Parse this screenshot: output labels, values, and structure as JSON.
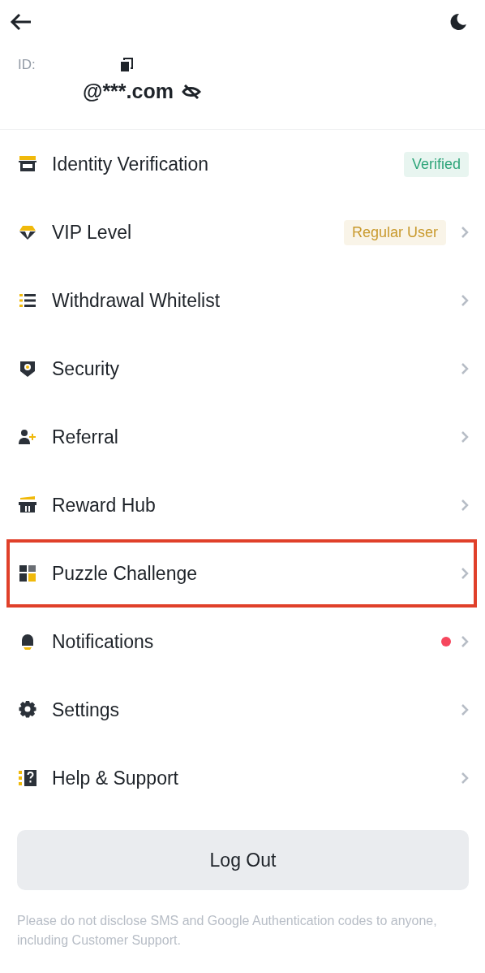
{
  "header": {
    "id_label": "ID:",
    "email": "@***.com"
  },
  "items": [
    {
      "label": "Identity Verification",
      "badge": {
        "text": "Verified",
        "color": "#2ea57a"
      },
      "chevron": false,
      "dot": false,
      "highlighted": false
    },
    {
      "label": "VIP Level",
      "badge": {
        "text": "Regular User",
        "color": "#c99a2e"
      },
      "chevron": true,
      "dot": false,
      "highlighted": false
    },
    {
      "label": "Withdrawal Whitelist",
      "chevron": true,
      "dot": false,
      "highlighted": false
    },
    {
      "label": "Security",
      "chevron": true,
      "dot": false,
      "highlighted": false
    },
    {
      "label": "Referral",
      "chevron": true,
      "dot": false,
      "highlighted": false
    },
    {
      "label": "Reward Hub",
      "chevron": true,
      "dot": false,
      "highlighted": false
    },
    {
      "label": "Puzzle Challenge",
      "chevron": true,
      "dot": false,
      "highlighted": true
    },
    {
      "label": "Notifications",
      "chevron": true,
      "dot": true,
      "highlighted": false
    },
    {
      "label": "Settings",
      "chevron": true,
      "dot": false,
      "highlighted": false
    },
    {
      "label": "Help & Support",
      "chevron": true,
      "dot": false,
      "highlighted": false
    }
  ],
  "logout_button": "Log Out",
  "footer_note": "Please do not disclose SMS and Google Authentication codes to anyone, including Customer Support."
}
